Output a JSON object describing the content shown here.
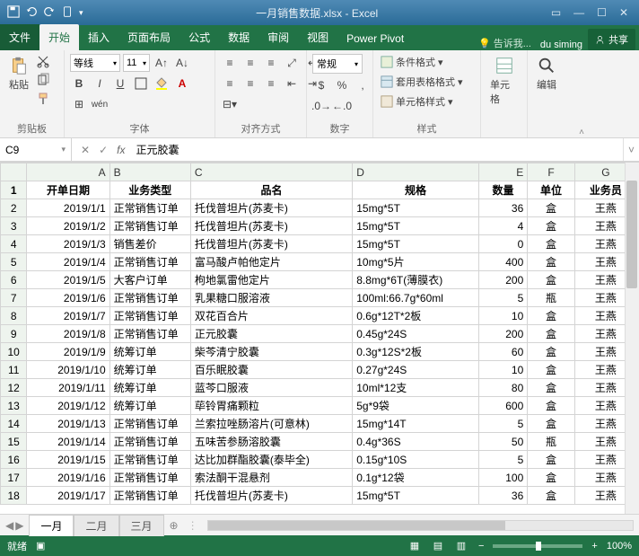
{
  "title": "一月销售数据.xlsx - Excel",
  "tabs": {
    "file": "文件",
    "home": "开始",
    "insert": "插入",
    "layout": "页面布局",
    "formula": "公式",
    "data": "数据",
    "review": "审阅",
    "view": "视图",
    "powerpivot": "Power Pivot"
  },
  "tellme": "告诉我...",
  "account": "du siming",
  "share": "共享",
  "ribbon": {
    "clipboard": {
      "paste": "粘贴",
      "label": "剪贴板"
    },
    "font": {
      "name": "等线",
      "size": "11",
      "label": "字体"
    },
    "align": {
      "label": "对齐方式"
    },
    "number": {
      "format": "常规",
      "label": "数字"
    },
    "styles": {
      "cond": "条件格式",
      "tbl": "套用表格格式",
      "cell": "单元格样式",
      "label": "样式"
    },
    "cells": {
      "label": "单元格"
    },
    "editing": {
      "label": "编辑"
    }
  },
  "namebox": "C9",
  "formula": "正元胶囊",
  "columns": [
    "A",
    "B",
    "C",
    "D",
    "E",
    "F",
    "G"
  ],
  "header": [
    "开单日期",
    "业务类型",
    "品名",
    "规格",
    "数量",
    "单位",
    "业务员"
  ],
  "rows": [
    [
      "2019/1/1",
      "正常销售订单",
      "托伐普坦片(苏麦卡)",
      "15mg*5T",
      "36",
      "盒",
      "王燕"
    ],
    [
      "2019/1/2",
      "正常销售订单",
      "托伐普坦片(苏麦卡)",
      "15mg*5T",
      "4",
      "盒",
      "王燕"
    ],
    [
      "2019/1/3",
      "销售差价",
      "托伐普坦片(苏麦卡)",
      "15mg*5T",
      "0",
      "盒",
      "王燕"
    ],
    [
      "2019/1/4",
      "正常销售订单",
      "富马酸卢帕他定片",
      "10mg*5片",
      "400",
      "盒",
      "王燕"
    ],
    [
      "2019/1/5",
      "大客户订单",
      "枸地氯雷他定片",
      "8.8mg*6T(薄膜衣)",
      "200",
      "盒",
      "王燕"
    ],
    [
      "2019/1/6",
      "正常销售订单",
      "乳果糖口服溶液",
      "100ml:66.7g*60ml",
      "5",
      "瓶",
      "王燕"
    ],
    [
      "2019/1/7",
      "正常销售订单",
      "双花百合片",
      "0.6g*12T*2板",
      "10",
      "盒",
      "王燕"
    ],
    [
      "2019/1/8",
      "正常销售订单",
      "正元胶囊",
      "0.45g*24S",
      "200",
      "盒",
      "王燕"
    ],
    [
      "2019/1/9",
      "统筹订单",
      "柴芩清宁胶囊",
      "0.3g*12S*2板",
      "60",
      "盒",
      "王燕"
    ],
    [
      "2019/1/10",
      "统筹订单",
      "百乐眠胶囊",
      "0.27g*24S",
      "10",
      "盒",
      "王燕"
    ],
    [
      "2019/1/11",
      "统筹订单",
      "蓝芩口服液",
      "10ml*12支",
      "80",
      "盒",
      "王燕"
    ],
    [
      "2019/1/12",
      "统筹订单",
      "荜铃胃痛颗粒",
      "5g*9袋",
      "600",
      "盒",
      "王燕"
    ],
    [
      "2019/1/13",
      "正常销售订单",
      "兰索拉唑肠溶片(可意林)",
      "15mg*14T",
      "5",
      "盒",
      "王燕"
    ],
    [
      "2019/1/14",
      "正常销售订单",
      "五味苦参肠溶胶囊",
      "0.4g*36S",
      "50",
      "瓶",
      "王燕"
    ],
    [
      "2019/1/15",
      "正常销售订单",
      "达比加群酯胶囊(泰毕全)",
      "0.15g*10S",
      "5",
      "盒",
      "王燕"
    ],
    [
      "2019/1/16",
      "正常销售订单",
      "索法酮干混悬剂",
      "0.1g*12袋",
      "100",
      "盒",
      "王燕"
    ],
    [
      "2019/1/17",
      "正常销售订单",
      "托伐普坦片(苏麦卡)",
      "15mg*5T",
      "36",
      "盒",
      "王燕"
    ]
  ],
  "sheets": {
    "s1": "一月",
    "s2": "二月",
    "s3": "三月"
  },
  "status": {
    "ready": "就绪",
    "zoom": "100%"
  },
  "chart_data": null
}
